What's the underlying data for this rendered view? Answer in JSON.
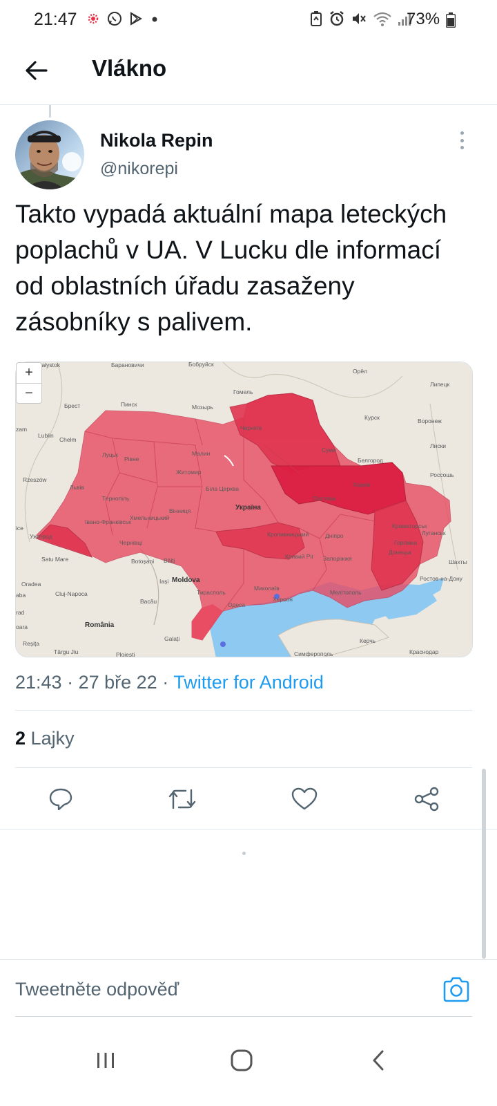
{
  "status_bar": {
    "time": "21:47",
    "battery": "73%",
    "left_icons": [
      "notification-dot-icon",
      "whatsapp-icon",
      "play-store-icon",
      "dot-icon"
    ],
    "right_icons": [
      "battery-saver-icon",
      "alarm-icon",
      "mute-icon",
      "wifi-icon",
      "signal-icon",
      "battery-icon"
    ]
  },
  "header": {
    "title": "Vlákno"
  },
  "tweet": {
    "display_name": "Nikola Repin",
    "handle": "@nikorepi",
    "text": "Takto vypadá aktuální mapa leteckých poplachů v UA. V Lucku dle informací od oblastních úřadu zasaženy zásobníky s palivem.",
    "time": "21:43",
    "date": "27 bře 22",
    "source": "Twitter for Android",
    "separator": "·",
    "likes_count": "2",
    "likes_label": "Lajky"
  },
  "map": {
    "zoom_in": "+",
    "zoom_out": "−",
    "alert_color": "#e8485f",
    "labels": {
      "bialystok": "Białystok",
      "baranovichi": "Барановичи",
      "bobruisk": "Бобруйск",
      "orel": "Орёл",
      "brest": "Брест",
      "pinsk": "Пинск",
      "mozyr": "Мозырь",
      "gomel": "Гомель",
      "lipetsk": "Липецк",
      "kursk": "Курск",
      "voronezh": "Воронеж",
      "lublin": "Lublin",
      "chelm": "Chełm",
      "chernihiv": "Чернігів",
      "sumy": "Суми",
      "lutsk": "Луцьк",
      "rivne": "Рівне",
      "zhytomyr": "Житомир",
      "malyn": "Малин",
      "belgorod": "Белгород",
      "liski": "Лиски",
      "rossosh": "Россошь",
      "rzeszow": "Rzeszów",
      "lviv": "Львів",
      "ternopil": "Тернопіль",
      "bila_tserkva": "Біла Церква",
      "ukraina": "Україна",
      "kharkiv": "Харків",
      "poltava": "Полтава",
      "vinnytsia": "Вінниця",
      "ivano_frankivsk": "Івано-Франківськ",
      "khmelnytskyi": "Хмельницький",
      "chernivtsi": "Чернівці",
      "kropyvnytskyi": "Кропивницький",
      "dnipro": "Дніпро",
      "kramatorsk": "Краматорськ",
      "luhansk": "Луганськ",
      "uzhhorod": "Ужгород",
      "horlivka": "Горлівка",
      "donetsk": "Донецьк",
      "kryvyi_rih": "Кривий Ріг",
      "zaporizhzhia": "Запоріжжя",
      "satu_mare": "Satu Mare",
      "botosani": "Botoșani",
      "balti": "Bălți",
      "shakhty": "Шахты",
      "rostov": "Ростов-на-Дону",
      "oradea": "Oradea",
      "moldova": "Moldova",
      "iasi": "Iași",
      "mykolaiv": "Миколаїв",
      "kherson": "Херсон",
      "melitopol": "Мелітополь",
      "cluj": "Cluj-Napoca",
      "tiraspol": "Тирасполь",
      "bacau": "Bacău",
      "odesa": "Одеса",
      "romania": "România",
      "galati": "Galați",
      "kerch": "Керчь",
      "resita": "Reșița",
      "targu_jiu": "Târgu Jiu",
      "ploiesti": "Ploiești",
      "simferopol": "Симферополь",
      "krasnodar": "Краснодар",
      "zam": "zam",
      "ice": "ice",
      "aba": "aba",
      "rad": "rad",
      "oara": "oara"
    }
  },
  "actions": {
    "reply": "reply-icon",
    "retweet": "retweet-icon",
    "like": "heart-icon",
    "share": "share-icon"
  },
  "reply_bar": {
    "placeholder": "Tweetněte odpověď"
  },
  "nav": {
    "recents": "recents-icon",
    "home": "home-icon",
    "back": "back-icon"
  }
}
